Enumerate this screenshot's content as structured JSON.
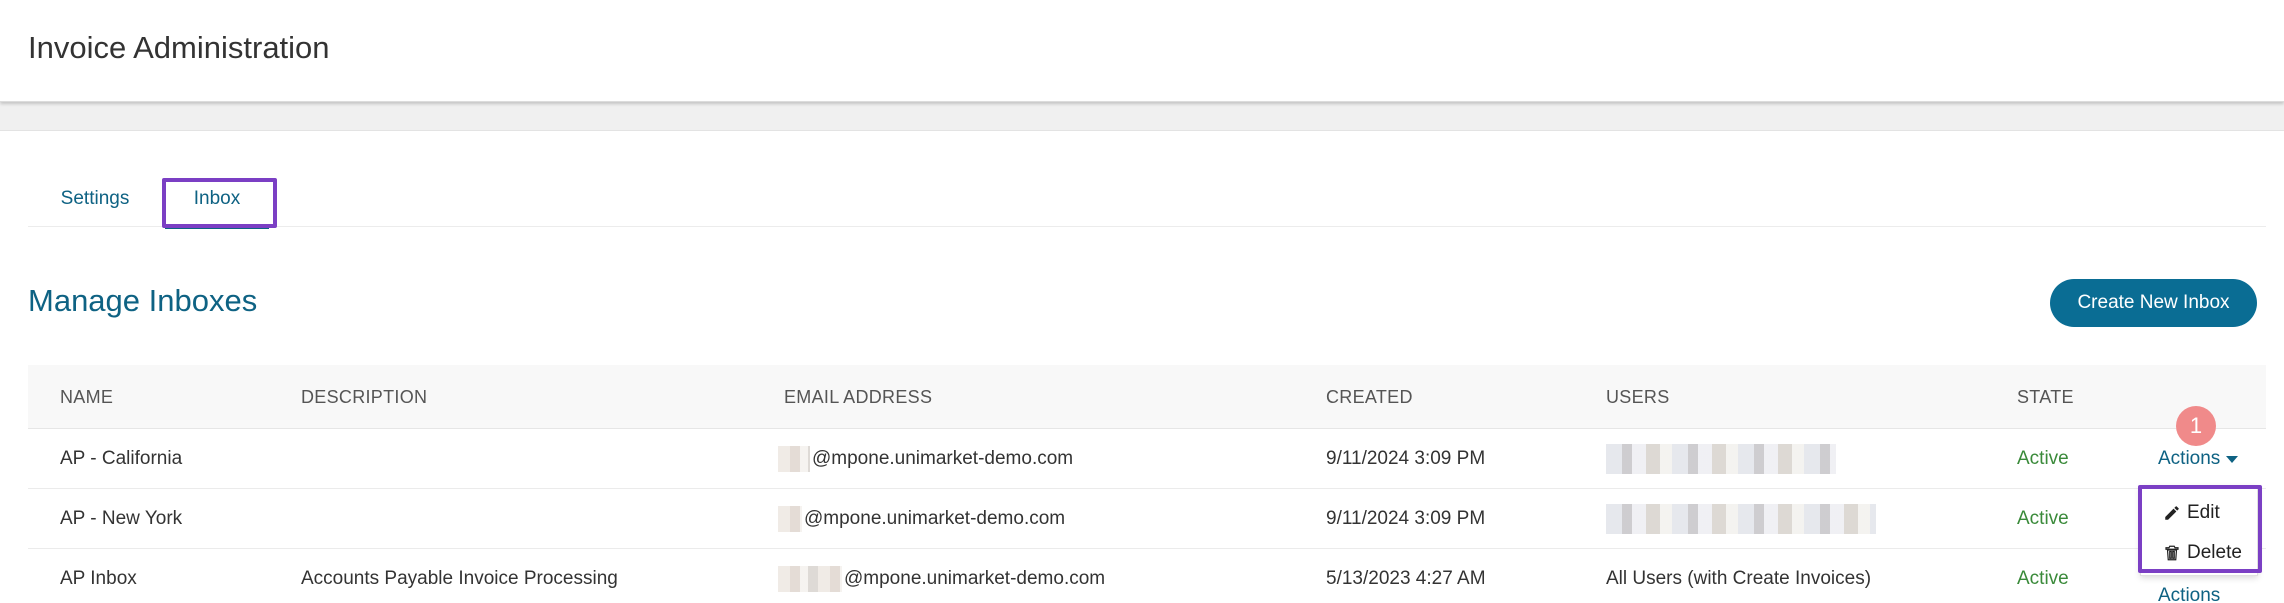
{
  "header": {
    "title": "Invoice Administration"
  },
  "tabs": [
    {
      "label": "Settings",
      "active": false
    },
    {
      "label": "Inbox",
      "active": true
    }
  ],
  "section": {
    "title": "Manage Inboxes",
    "create_button": "Create New Inbox"
  },
  "table": {
    "columns": [
      "NAME",
      "DESCRIPTION",
      "EMAIL ADDRESS",
      "CREATED",
      "USERS",
      "STATE"
    ],
    "rows": [
      {
        "name": "AP - California",
        "description": "",
        "email_domain": "@mpone.unimarket-demo.com",
        "created": "9/11/2024 3:09 PM",
        "users": "",
        "state": "Active",
        "actions": "Actions"
      },
      {
        "name": "AP - New York",
        "description": "",
        "email_domain": "@mpone.unimarket-demo.com",
        "created": "9/11/2024 3:09 PM",
        "users": "",
        "state": "Active",
        "actions": ""
      },
      {
        "name": "AP Inbox",
        "description": "Accounts Payable Invoice Processing",
        "email_domain": "@mpone.unimarket-demo.com",
        "created": "5/13/2023 4:27 AM",
        "users": "All Users (with Create Invoices)",
        "state": "Active",
        "actions": ""
      }
    ]
  },
  "annotation": {
    "step_number": "1"
  },
  "actions_menu": {
    "items": [
      {
        "label": "Edit",
        "icon": "pencil-icon"
      },
      {
        "label": "Delete",
        "icon": "trash-icon"
      }
    ]
  },
  "colors": {
    "accent": "#0e6283",
    "button": "#0a6d94",
    "active_state": "#3a8a3a",
    "highlight": "#7b3fc4",
    "badge": "#f08a8a"
  }
}
